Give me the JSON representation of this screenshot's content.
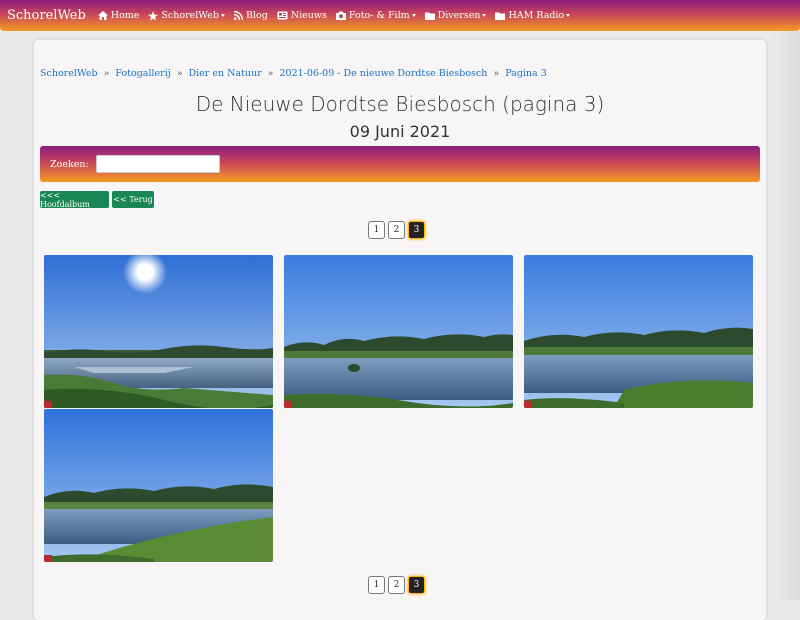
{
  "nav": {
    "brand": "SchorelWeb",
    "items": [
      {
        "label": "Home",
        "icon": "home-icon"
      },
      {
        "label": "SchorelWeb",
        "icon": "star-icon",
        "dropdown": true
      },
      {
        "label": "Blog",
        "icon": "rss-icon"
      },
      {
        "label": "Nieuws",
        "icon": "newspaper-icon"
      },
      {
        "label": "Foto- & Film",
        "icon": "camera-icon",
        "dropdown": true
      },
      {
        "label": "Diversen",
        "icon": "folder-icon",
        "dropdown": true
      },
      {
        "label": "HAM Radio",
        "icon": "folder-icon",
        "dropdown": true
      }
    ]
  },
  "breadcrumb": [
    "SchorelWeb",
    "Fotogallerij",
    "Dier en Natuur",
    "2021-06-09 - De nieuwe Dordtse Biesbosch",
    "Pagina 3"
  ],
  "page": {
    "title": "De Nieuwe Dordtse Biesbosch (pagina 3)",
    "subtitle": "09 Juni 2021"
  },
  "search": {
    "label": "Zoeken:",
    "value": "",
    "placeholder": ""
  },
  "buttons": {
    "main_album": "<<< Hoofdalbum",
    "back": "<< Terug"
  },
  "pagination": {
    "pages": [
      "1",
      "2",
      "3"
    ],
    "current": "3"
  },
  "photos": [
    {
      "variant": "sun"
    },
    {
      "variant": "lake"
    },
    {
      "variant": "lake2"
    },
    {
      "variant": "grass"
    }
  ],
  "colors": {
    "gradient_top": "#8a1e7e",
    "gradient_bottom": "#f59a23",
    "link": "#1a72c9",
    "button_green": "#198754"
  }
}
